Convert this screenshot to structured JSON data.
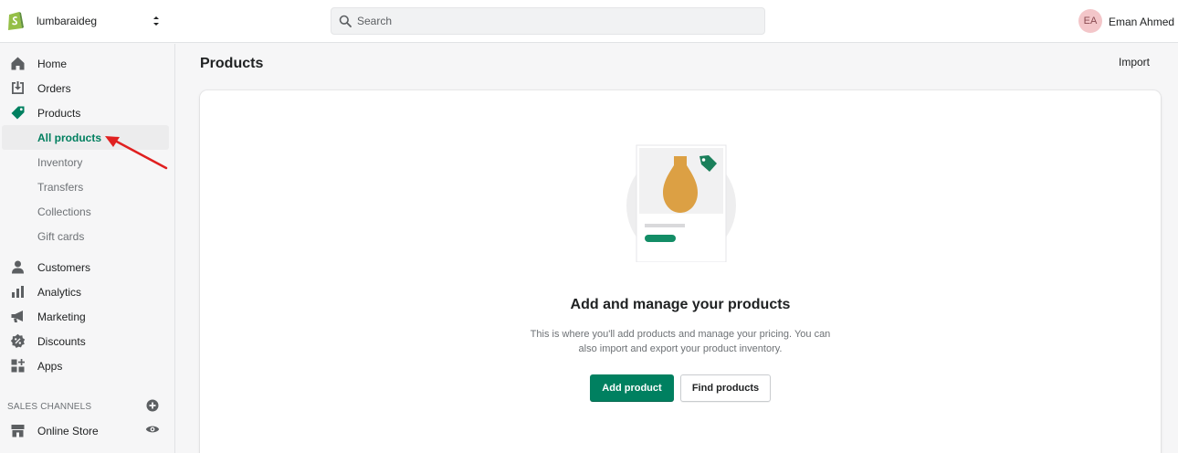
{
  "topbar": {
    "store_name": "lumbaraideg",
    "search_placeholder": "Search",
    "user_initials": "EA",
    "user_name": "Eman Ahmed"
  },
  "sidebar": {
    "items": [
      {
        "label": "Home",
        "icon": "home-icon"
      },
      {
        "label": "Orders",
        "icon": "orders-icon"
      },
      {
        "label": "Products",
        "icon": "tag-icon"
      },
      {
        "label": "All products",
        "selected": true
      },
      {
        "label": "Inventory"
      },
      {
        "label": "Transfers"
      },
      {
        "label": "Collections"
      },
      {
        "label": "Gift cards"
      },
      {
        "label": "Customers",
        "icon": "person-icon"
      },
      {
        "label": "Analytics",
        "icon": "bar-chart-icon"
      },
      {
        "label": "Marketing",
        "icon": "megaphone-icon"
      },
      {
        "label": "Discounts",
        "icon": "discount-icon"
      },
      {
        "label": "Apps",
        "icon": "apps-icon"
      }
    ],
    "sales_channels_label": "SALES CHANNELS",
    "online_store_label": "Online Store"
  },
  "main": {
    "title": "Products",
    "import_label": "Import",
    "empty_state": {
      "heading": "Add and manage your products",
      "body": "This is where you'll add products and manage your pricing. You can also import and export your product inventory.",
      "primary_action": "Add product",
      "secondary_action": "Find products"
    }
  },
  "colors": {
    "accent_green": "#008060",
    "selected_text": "#007f5f",
    "annotation_arrow": "#e02020"
  }
}
